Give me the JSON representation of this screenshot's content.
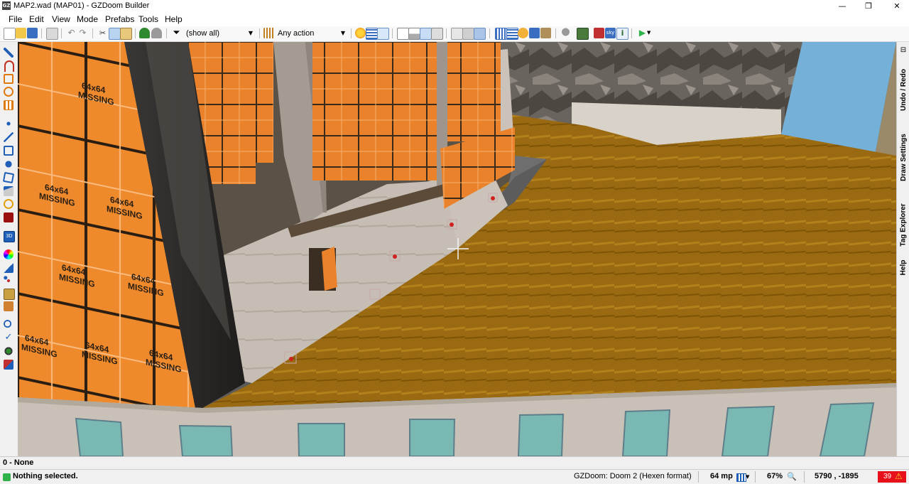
{
  "window": {
    "title": "MAP2.wad (MAP01) - GZDoom Builder",
    "app_icon": "GZ"
  },
  "window_controls": {
    "minimize": "—",
    "maximize": "❐",
    "close": "✕"
  },
  "menu": {
    "file": "File",
    "edit": "Edit",
    "view": "View",
    "mode": "Mode",
    "prefabs": "Prefabs",
    "tools": "Tools",
    "help": "Help"
  },
  "toolbar": {
    "filter_value": "(show all)",
    "action_value": "Any action"
  },
  "dock_tabs": {
    "undo_redo": "Undo / Redo",
    "draw_settings": "Draw Settings",
    "tag_explorer": "Tag Explorer",
    "help": "Help"
  },
  "viewport": {
    "missing_texture_label": "64x64\nMISSING"
  },
  "infobar": {
    "text": "0 - None"
  },
  "status": {
    "message": "Nothing selected.",
    "game_config": "GZDoom: Doom 2 (Hexen format)",
    "grid_size": "64 mp",
    "zoom": "67%",
    "coords": "5790 , -1895",
    "warnings_count": "39"
  },
  "colors": {
    "accent_green": "#2fb24a",
    "warning_red": "#e8101a",
    "floor": "#9a6a12",
    "crate": "#e9822a",
    "sky": "#75b0d8"
  }
}
